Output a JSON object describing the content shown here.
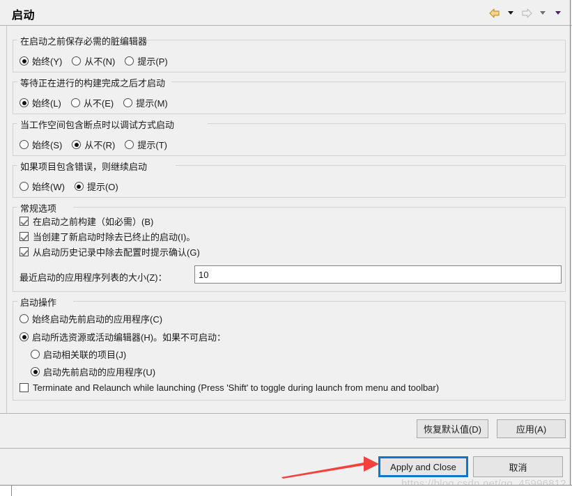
{
  "window": {
    "title": "启动"
  },
  "nav": {
    "back_icon": "back-arrow-icon",
    "back_dropdown_icon": "chevron-down-icon",
    "forward_icon": "forward-arrow-icon",
    "forward_dropdown_icon": "chevron-down-icon",
    "menu_dropdown_icon": "chevron-down-icon"
  },
  "groups": [
    {
      "legend": "在启动之前保存必需的脏编辑器",
      "options": [
        {
          "label": "始终(Y)",
          "checked": true
        },
        {
          "label": "从不(N)",
          "checked": false
        },
        {
          "label": "提示(P)",
          "checked": false
        }
      ]
    },
    {
      "legend": "等待正在进行的构建完成之后才启动",
      "options": [
        {
          "label": "始终(L)",
          "checked": true
        },
        {
          "label": "从不(E)",
          "checked": false
        },
        {
          "label": "提示(M)",
          "checked": false
        }
      ]
    },
    {
      "legend": "当工作空间包含断点时以调试方式启动",
      "options": [
        {
          "label": "始终(S)",
          "checked": false
        },
        {
          "label": "从不(R)",
          "checked": true
        },
        {
          "label": "提示(T)",
          "checked": false
        }
      ]
    },
    {
      "legend": "如果项目包含错误，则继续启动",
      "options": [
        {
          "label": "始终(W)",
          "checked": false
        },
        {
          "label": "提示(O)",
          "checked": true
        }
      ]
    }
  ],
  "general_options": {
    "legend": "常规选项",
    "checkboxes": [
      {
        "label": "在启动之前构建（如必需）(B)",
        "checked": true
      },
      {
        "label": "当创建了新启动时除去已终止的启动(I)。",
        "checked": true
      },
      {
        "label": "从启动历史记录中除去配置时提示确认(G)",
        "checked": true
      }
    ],
    "recent_size_label": "最近启动的应用程序列表的大小(Z)：",
    "recent_size_value": "10",
    "recent_size_placeholder": ""
  },
  "launch_operation": {
    "legend": "启动操作",
    "radios": [
      {
        "label": "始终启动先前启动的应用程序(C)",
        "checked": false
      },
      {
        "label": "启动所选资源或活动编辑器(H)。如果不可启动：",
        "checked": true
      }
    ],
    "sub_radios": [
      {
        "label": "启动相关联的项目(J)",
        "checked": false
      },
      {
        "label": "启动先前启动的应用程序(U)",
        "checked": true
      }
    ],
    "terminate_checkbox": {
      "label": "Terminate and Relaunch while launching (Press 'Shift' to toggle during launch from menu and toolbar)",
      "checked": false
    }
  },
  "action_buttons": {
    "restore_defaults": "恢复默认值(D)",
    "apply": "应用(A)"
  },
  "dialog_buttons": {
    "apply_and_close": "Apply and Close",
    "cancel": "取消"
  },
  "annotation": {
    "arrow_color": "#f6403c",
    "target": "Apply and Close"
  },
  "watermark": {
    "text": "https://blog.csdn.net/qq_45996812"
  },
  "colors": {
    "focus_outline": "#0b76d0",
    "dialog_bg": "#f0f0f0",
    "group_border": "#d2d2d2"
  }
}
